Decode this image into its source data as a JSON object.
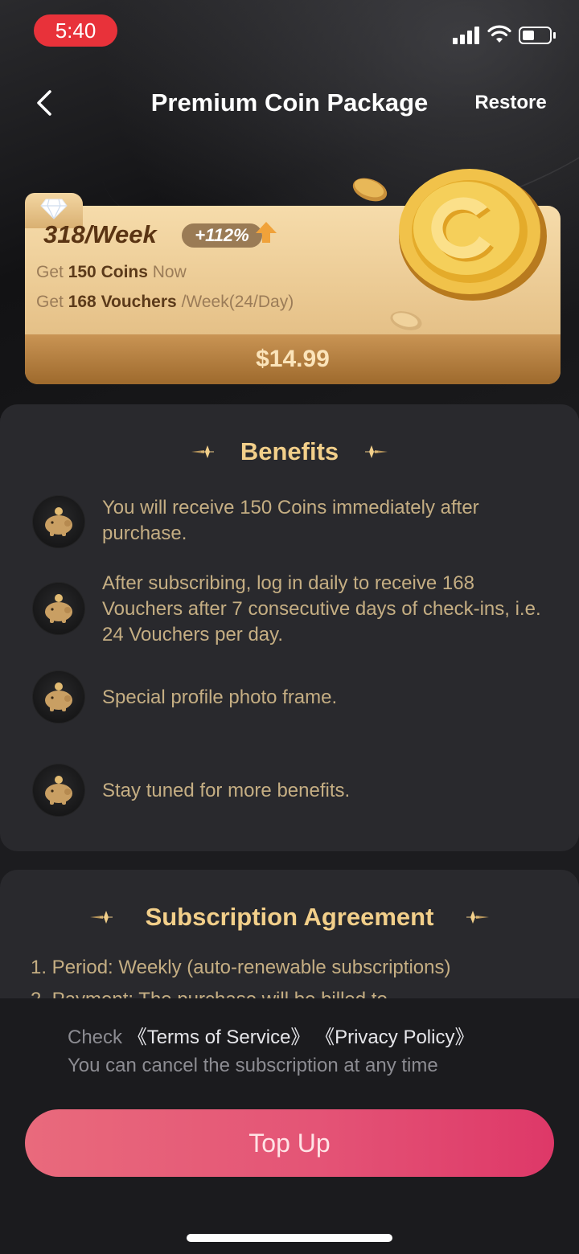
{
  "status_bar": {
    "time": "5:40"
  },
  "header": {
    "title": "Premium Coin Package",
    "restore_label": "Restore"
  },
  "package": {
    "title": "318/Week",
    "bonus": "+112%",
    "line1": {
      "prefix": "Get",
      "bold": "150 Coins",
      "suffix": "Now"
    },
    "line2": {
      "prefix": "Get",
      "bold": "168 Vouchers",
      "suffix": "/Week(24/Day)"
    },
    "price": "$14.99"
  },
  "benefits": {
    "heading": "Benefits",
    "items": [
      {
        "text": "You will receive 150 Coins immediately after purchase."
      },
      {
        "text": "After subscribing, log in daily to receive 168 Vouchers after 7 consecutive days of check-ins, i.e. 24 Vouchers per day."
      },
      {
        "text": "Special profile photo frame."
      },
      {
        "text": "Stay tuned for more benefits."
      }
    ]
  },
  "agreement": {
    "heading": "Subscription Agreement",
    "line1": "1. Period: Weekly (auto-renewable subscriptions)",
    "line2": "2. Payment: The purchase will be billed to"
  },
  "footer": {
    "check_label": "Check",
    "terms_link": "《Terms of Service》",
    "privacy_link": "《Privacy Policy》",
    "cancel_note": "You can cancel the subscription at any time",
    "topup_label": "Top Up"
  },
  "colors": {
    "accent_gold": "#f2cf8a",
    "benefit_text": "#c5ae83",
    "button_start": "#e96a7c",
    "button_end": "#de3868",
    "status_pill": "#e8323a"
  },
  "icons": [
    "chevron-left-icon",
    "signal-icon",
    "wifi-icon",
    "battery-icon",
    "diamond-icon",
    "up-arrow-icon",
    "coin-icon",
    "piggy-bank-icon",
    "sparkle-icon"
  ]
}
